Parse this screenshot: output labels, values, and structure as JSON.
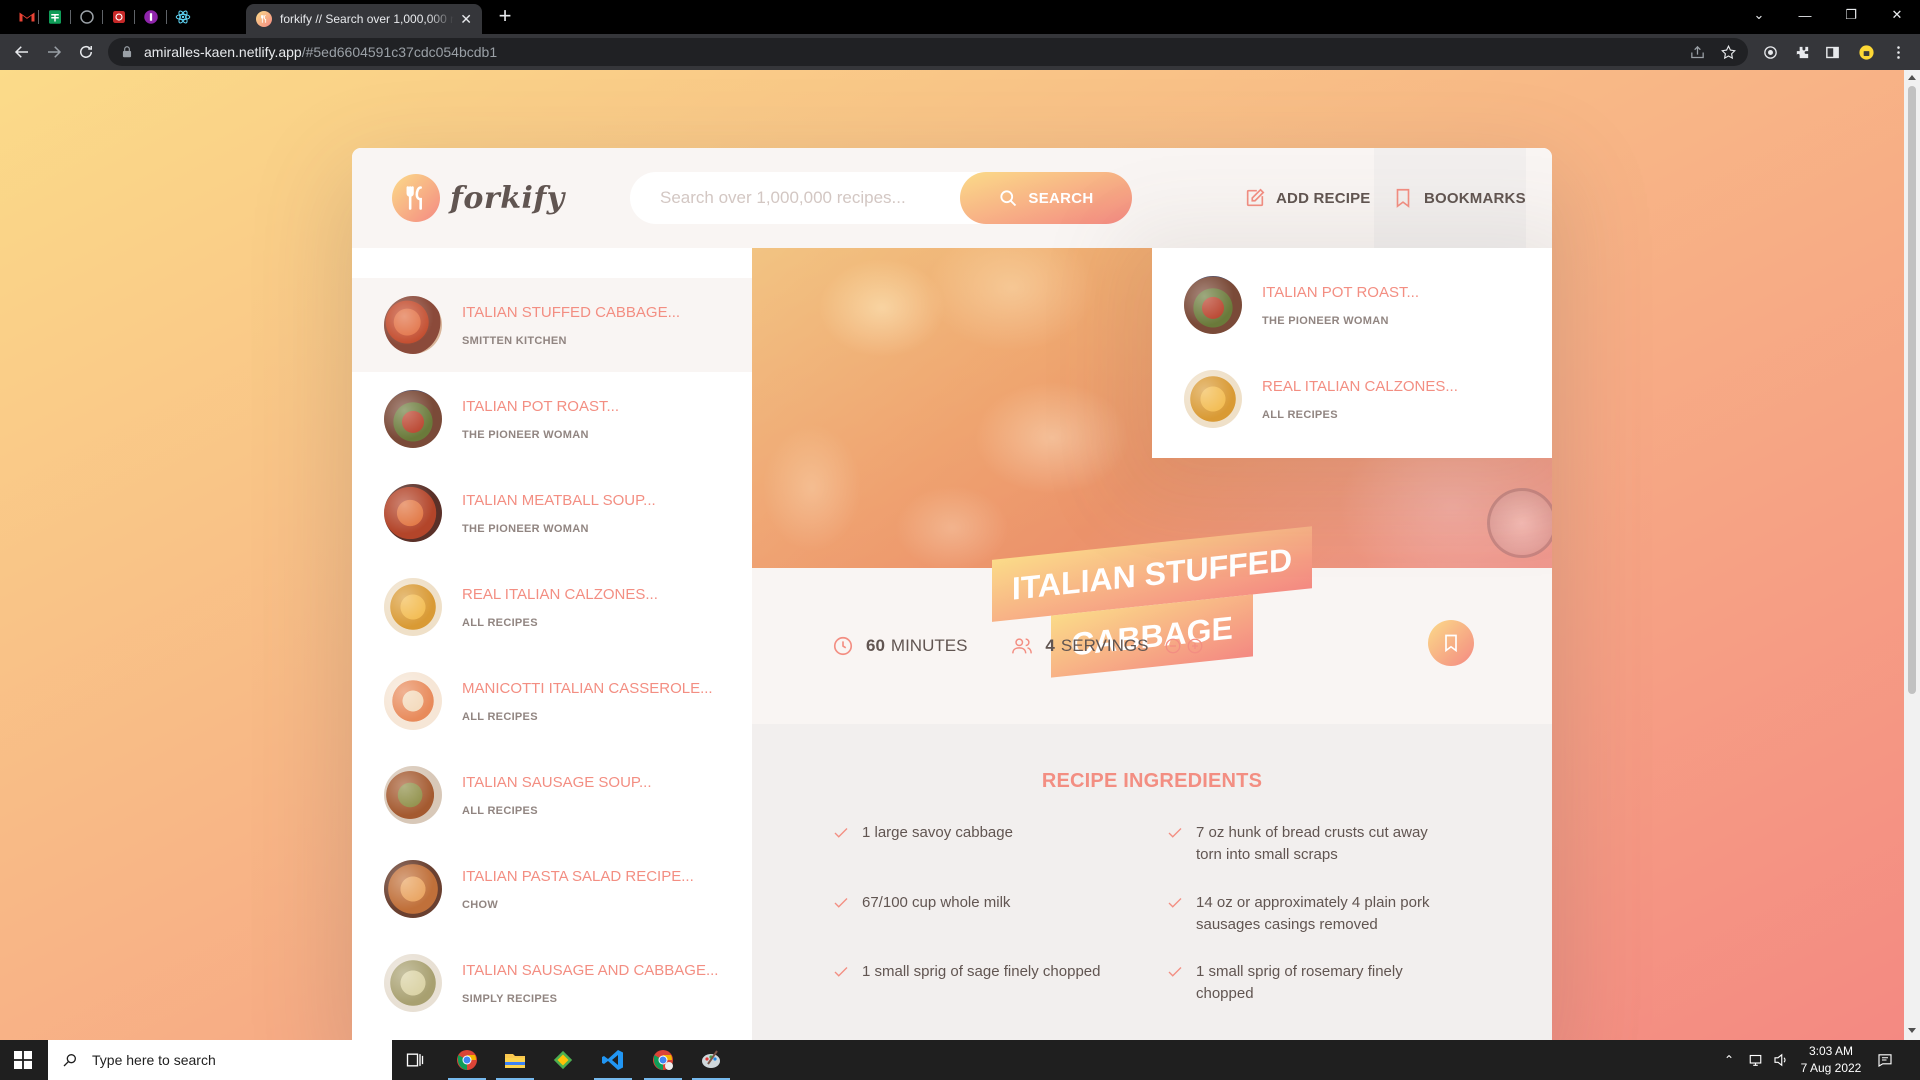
{
  "browser": {
    "tab_title": "forkify // Search over 1,000,000 recipes",
    "url_host": "amiralles-kaen.netlify.app",
    "url_path": "/#5ed6604591c37cdc054bcdb1"
  },
  "header": {
    "logo_text": "forkify",
    "search_placeholder": "Search over 1,000,000 recipes...",
    "search_button": "SEARCH",
    "add_recipe": "ADD RECIPE",
    "bookmarks": "BOOKMARKS"
  },
  "results": [
    {
      "title": "ITALIAN STUFFED CABBAGE...",
      "publisher": "SMITTEN KITCHEN"
    },
    {
      "title": "ITALIAN POT ROAST...",
      "publisher": "THE PIONEER WOMAN"
    },
    {
      "title": "ITALIAN MEATBALL SOUP...",
      "publisher": "THE PIONEER WOMAN"
    },
    {
      "title": "REAL ITALIAN CALZONES...",
      "publisher": "ALL RECIPES"
    },
    {
      "title": "MANICOTTI ITALIAN CASSEROLE...",
      "publisher": "ALL RECIPES"
    },
    {
      "title": "ITALIAN SAUSAGE SOUP...",
      "publisher": "ALL RECIPES"
    },
    {
      "title": "ITALIAN PASTA SALAD RECIPE...",
      "publisher": "CHOW"
    },
    {
      "title": "ITALIAN SAUSAGE AND CABBAGE...",
      "publisher": "SIMPLY RECIPES"
    }
  ],
  "bookmarks_list": [
    {
      "title": "ITALIAN POT ROAST...",
      "publisher": "THE PIONEER WOMAN"
    },
    {
      "title": "REAL ITALIAN CALZONES...",
      "publisher": "ALL RECIPES"
    }
  ],
  "recipe": {
    "title_line1": "ITALIAN STUFFED",
    "title_line2": "CABBAGE",
    "minutes_value": "60",
    "minutes_unit": "MINUTES",
    "servings_value": "4",
    "servings_unit": "SERVINGS",
    "ingredients_heading": "RECIPE INGREDIENTS",
    "ingredients": [
      "1 large savoy cabbage",
      "7 oz hunk of bread crusts cut away torn into small scraps",
      "67/100 cup whole milk",
      "14 oz or approximately 4 plain pork sausages casings removed",
      "1 small sprig of sage finely chopped",
      "1 small sprig of rosemary finely chopped"
    ]
  },
  "taskbar": {
    "search_placeholder": "Type here to search",
    "time": "3:03 AM",
    "date": "7 Aug 2022"
  },
  "colors": {
    "accent": "#f38e82",
    "gradient_start": "#fbdb89",
    "gradient_end": "#f48982",
    "text": "#615551"
  }
}
